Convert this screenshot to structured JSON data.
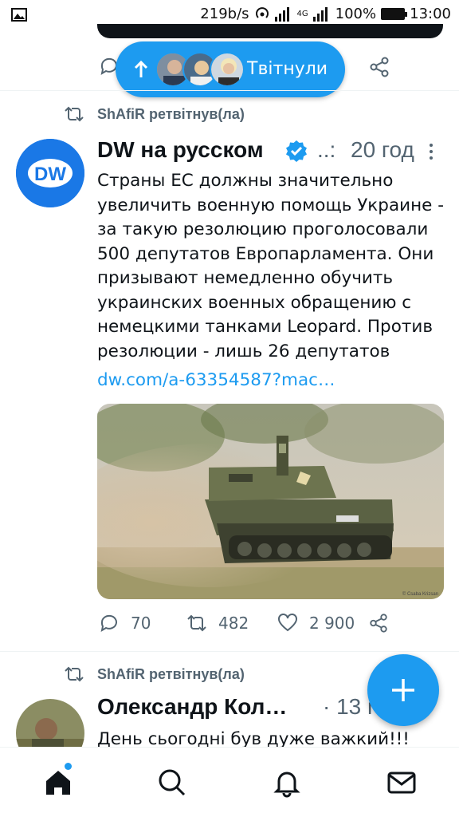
{
  "status_bar": {
    "speed": "219b/s",
    "network": "4G",
    "battery": "100%",
    "time": "13:00"
  },
  "new_tweets_pill": {
    "label": "Твітнули"
  },
  "tweet1": {
    "retweeted_by": "ShAfiR ретвітнув(ла)",
    "author_name": "DW на русском",
    "author_handle_truncated": "..:",
    "time": "20 год",
    "text_lines": [
      "Страны ЕС должны значительно",
      "увеличить военную помощь Украине -",
      "за такую резолюцию проголосовали",
      "500 депутатов Европарламента. Они",
      "призывают немедленно обучить",
      "украинских военных обращению с",
      "немецкими танками Leopard. Против",
      "резолюции - лишь 26 депутатов"
    ],
    "link": "dw.com/a-63354587?mac…",
    "media_credit": "© Csaba Krizsan",
    "replies": "70",
    "retweets": "482",
    "likes": "2 900"
  },
  "tweet2": {
    "retweeted_by": "ShAfiR ретвітнув(ла)",
    "author_name": "Олександр Кол…",
    "time": "· 13 год",
    "text": "День сьогодні був дуже важкий!!!"
  },
  "fab": {
    "icon": "plus-icon"
  },
  "bottom_nav": {
    "items": [
      "home-icon",
      "search-icon",
      "notifications-icon",
      "messages-icon"
    ]
  },
  "colors": {
    "accent": "#1d9bf0",
    "text": "#0f1419",
    "muted": "#536471",
    "dw_blue": "#1a78e6"
  }
}
